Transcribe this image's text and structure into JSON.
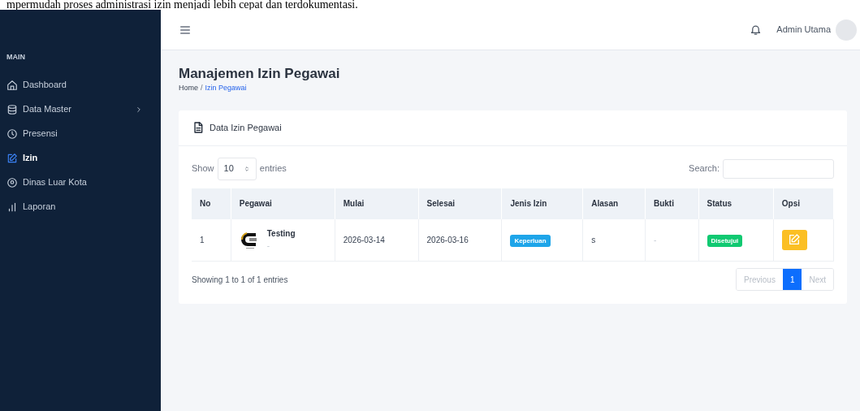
{
  "document_caption": "mpermudah proses administrasi izin menjadi lebih cepat dan terdokumentasi.",
  "topbar": {
    "user_name": "Admin Utama"
  },
  "sidebar": {
    "section": "MAIN",
    "items": [
      {
        "label": "Dashboard",
        "selected": false,
        "expandable": false
      },
      {
        "label": "Data Master",
        "selected": false,
        "expandable": true
      },
      {
        "label": "Presensi",
        "selected": false,
        "expandable": false
      },
      {
        "label": "Izin",
        "selected": true,
        "expandable": false
      },
      {
        "label": "Dinas Luar Kota",
        "selected": false,
        "expandable": false
      },
      {
        "label": "Laporan",
        "selected": false,
        "expandable": false
      }
    ]
  },
  "page": {
    "title": "Manajemen Izin Pegawai",
    "breadcrumb_separator": "/",
    "breadcrumb": [
      {
        "label": "Home",
        "current": false
      },
      {
        "label": "Izin Pegawai",
        "current": true
      }
    ]
  },
  "card": {
    "title": "Data Izin Pegawai",
    "length": {
      "label_before": "Show",
      "value": "10",
      "label_after": "entries"
    },
    "search": {
      "label": "Search:"
    },
    "table": {
      "columns": [
        "No",
        "Pegawai",
        "Mulai",
        "Selesai",
        "Jenis Izin",
        "Alasan",
        "Bukti",
        "Status",
        "Opsi"
      ],
      "rows": [
        {
          "no": "1",
          "pegawai": "Testing",
          "pegawai_sub": "-",
          "mulai": "2026-03-14",
          "selesai": "2026-03-16",
          "jenis_izin": {
            "label": "Keperluan",
            "color": "#1ea5e9"
          },
          "alasan": "s",
          "bukti": "-",
          "status": {
            "label": "Disetujui",
            "color": "#10c971"
          }
        }
      ]
    },
    "info": "Showing 1 to 1 of 1 entries",
    "pagination": [
      {
        "label": "Previous",
        "selected": false
      },
      {
        "label": "1",
        "selected": true
      },
      {
        "label": "Next",
        "selected": false
      }
    ]
  }
}
